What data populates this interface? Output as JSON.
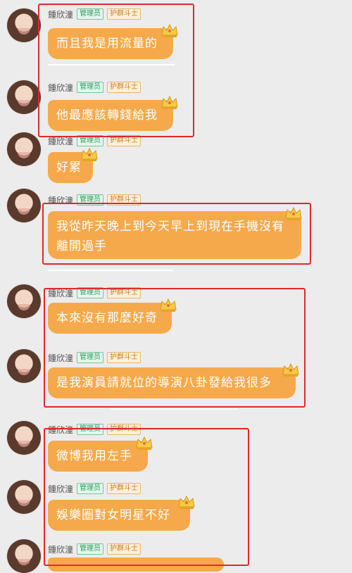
{
  "messages": [
    {
      "name": "鍾欣潼",
      "role_badge": "管理员",
      "title_badge": "护群斗士",
      "text": "而且我是用流量的"
    },
    {
      "name": "鍾欣潼",
      "role_badge": "管理员",
      "title_badge": "护群斗士",
      "text": "他最應該轉錢給我"
    },
    {
      "name": "鍾欣潼",
      "role_badge": "管理员",
      "title_badge": "护群斗士",
      "text": "好累"
    },
    {
      "name": "鍾欣潼",
      "role_badge": "管理员",
      "title_badge": "护群斗士",
      "text": "我從昨天晚上到今天早上到現在手機沒有離開過手"
    },
    {
      "name": "鍾欣潼",
      "role_badge": "管理员",
      "title_badge": "护群斗士",
      "text": "本來沒有那麼好奇"
    },
    {
      "name": "鍾欣潼",
      "role_badge": "管理员",
      "title_badge": "护群斗士",
      "text": "是我演員請就位的導演八卦發給我很多"
    },
    {
      "name": "鍾欣潼",
      "role_badge": "管理员",
      "title_badge": "护群斗士",
      "text": "微博我用左手"
    },
    {
      "name": "鍾欣潼",
      "role_badge": "管理员",
      "title_badge": "护群斗士",
      "text": "娛樂圈對女明星不好"
    },
    {
      "name": "鍾欣潼",
      "role_badge": "管理员",
      "title_badge": "护群斗士",
      "text": ""
    }
  ],
  "colors": {
    "bubble": "#f6a94a",
    "highlight_frame": "#e0292b",
    "admin_badge": "#2e9b61",
    "fighter_badge": "#c97b1e",
    "background": "#ececec"
  },
  "icons": {
    "avatar": "user-avatar-photo",
    "bubble_decoration": "crown-icon"
  }
}
